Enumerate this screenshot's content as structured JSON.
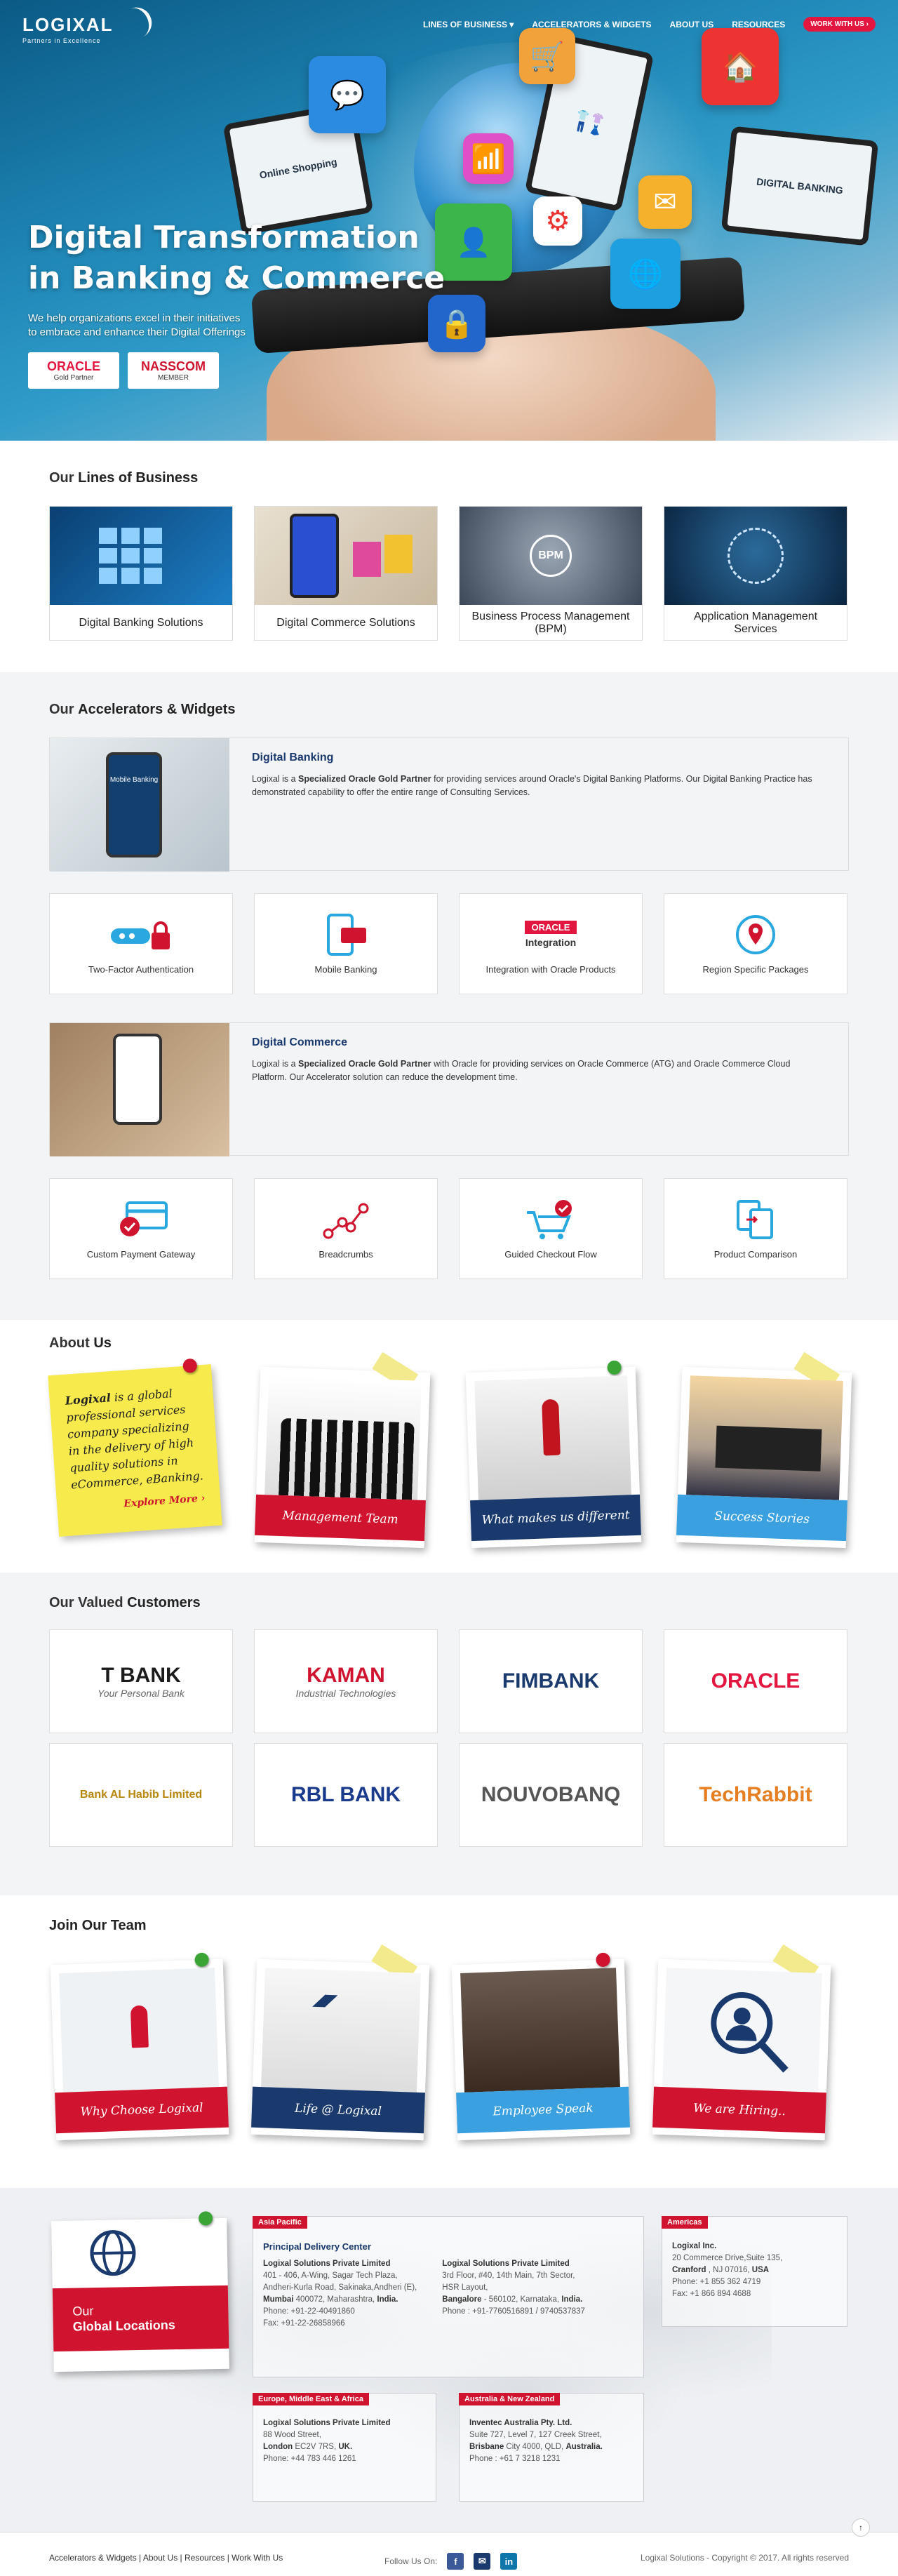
{
  "brand": {
    "name": "LOGIXAL",
    "tagline": "Partners in Excellence"
  },
  "nav": {
    "items": [
      "LINES OF BUSINESS ▾",
      "ACCELERATORS & WIDGETS",
      "ABOUT US",
      "RESOURCES"
    ],
    "cta": "WORK WITH US ›"
  },
  "hero": {
    "title_line1": "Digital Transformation",
    "title_line2": "in Banking & Commerce",
    "subtitle_line1": "We help organizations excel in their initiatives",
    "subtitle_line2": "to embrace and enhance their Digital Offerings",
    "badge1_main": "ORACLE",
    "badge1_sub": "Gold Partner",
    "badge2_main": "NASSCOM",
    "badge2_sub": "MEMBER",
    "screens": {
      "shopping": "Online Shopping",
      "banking": "DIGITAL BANKING"
    }
  },
  "lob": {
    "title_prefix": "Our ",
    "title_bold": "Lines of Business",
    "cards": [
      "Digital Banking Solutions",
      "Digital Commerce Solutions",
      "Business Process Management (BPM)",
      "Application Management Services"
    ]
  },
  "acc": {
    "title_prefix": "Our ",
    "title_bold": "Accelerators & Widgets",
    "banking": {
      "heading": "Digital Banking",
      "pre": "Logixal is a ",
      "bold": "Specialized Oracle Gold Partner",
      "post": " for providing services around Oracle's Digital Banking Platforms. Our Digital Banking Practice has demonstrated capability to offer the entire range of Consulting Services.",
      "phone_text": "Mobile Banking"
    },
    "banking_widgets": [
      "Two-Factor Authentication",
      "Mobile Banking",
      "Integration with Oracle Products",
      "Region Specific Packages"
    ],
    "oracle_integration": {
      "brand": "ORACLE",
      "label": "Integration"
    },
    "commerce": {
      "heading": "Digital Commerce",
      "pre": "Logixal is a ",
      "bold": "Specialized Oracle Gold Partner",
      "post": " with Oracle for providing services on Oracle Commerce (ATG) and Oracle Commerce Cloud Platform. Our Accelerator solution can reduce the development time."
    },
    "commerce_widgets": [
      "Custom Payment Gateway",
      "Breadcrumbs",
      "Guided Checkout Flow",
      "Product Comparison"
    ]
  },
  "about": {
    "title_prefix": "About ",
    "title_bold": "Us",
    "note_bold": "Logixal",
    "note_text": " is a global professional services company specializing in the delivery of high quality solutions in eCommerce, eBanking.",
    "explore": "Explore More ›",
    "cards": [
      "Management Team",
      "What makes us different",
      "Success Stories"
    ]
  },
  "customers": {
    "title_prefix": "Our Valued ",
    "title_bold": "Customers",
    "logos": [
      {
        "name": "T BANK",
        "sub": "Your Personal Bank",
        "color": "#1b1b1b"
      },
      {
        "name": "KAMAN",
        "sub": "Industrial Technologies",
        "color": "#d0142f"
      },
      {
        "name": "FIMBANK",
        "sub": "",
        "color": "#1a3a6e"
      },
      {
        "name": "ORACLE",
        "sub": "",
        "color": "#e3163f"
      },
      {
        "name": "Bank AL Habib Limited",
        "sub": "",
        "color": "#b8860b"
      },
      {
        "name": "RBL BANK",
        "sub": "",
        "color": "#1a3a8e"
      },
      {
        "name": "NOUVOBANQ",
        "sub": "",
        "color": "#555555"
      },
      {
        "name": "TechRabbit",
        "sub": "",
        "color": "#e67e22"
      }
    ]
  },
  "join": {
    "title": "Join Our Team",
    "cards": [
      "Why Choose Logixal",
      "Life @ Logixal",
      "Employee Speak",
      "We are Hiring.."
    ]
  },
  "locations": {
    "card_line1": "Our",
    "card_line2": "Global Locations",
    "asia": {
      "tag": "Asia Pacific",
      "center": "Principal Delivery Center",
      "mumbai": {
        "company": "Logixal Solutions Private Limited",
        "l1": "401 - 406, A-Wing, Sagar Tech Plaza,",
        "l2": "Andheri-Kurla Road, Sakinaka,Andheri (E),",
        "city": "Mumbai",
        "l3": " 400072, Maharashtra, ",
        "country": "India.",
        "phone": "Phone: +91-22-40491860",
        "fax": "Fax: +91-22-26858966"
      },
      "bangalore": {
        "company": "Logixal Solutions Private Limited",
        "l1": "3rd Floor, #40, 14th Main, 7th Sector,",
        "l2": "HSR Layout,",
        "city": "Bangalore",
        "l3": " - 560102, Karnataka, ",
        "country": "India.",
        "phone": "Phone : +91-7760516891 / 9740537837"
      }
    },
    "americas": {
      "tag": "Americas",
      "company": "Logixal Inc.",
      "l1": "20 Commerce Drive,Suite 135,",
      "city": "Cranford",
      "l2": " , NJ 07016, ",
      "country": "USA",
      "phone": "Phone: +1 855 362 4719",
      "fax": "Fax: +1 866 894 4688"
    },
    "emea": {
      "tag": "Europe, Middle East & Africa",
      "company": "Logixal Solutions Private Limited",
      "l1": "88 Wood Street,",
      "city": "London",
      "l2": " EC2V 7RS, ",
      "country": "UK.",
      "phone": "Phone: +44 783 446 1261"
    },
    "anz": {
      "tag": "Australia & New Zealand",
      "company": "Inventec Australia Pty. Ltd.",
      "l1": "Suite 727, Level 7, 127 Creek Street,",
      "city": "Brisbane",
      "l2": " City 4000, QLD, ",
      "country": "Australia.",
      "phone": "Phone : +61 7 3218 1231"
    }
  },
  "footer": {
    "links": [
      "Accelerators & Widgets",
      "About Us",
      "Resources",
      "Work With Us"
    ],
    "follow": "Follow Us On:",
    "social": [
      "f",
      "✉",
      "in"
    ],
    "copyright": "Logixal Solutions - Copyright © 2017. All rights reserved",
    "totop": "↑"
  },
  "colors": {
    "accent": "#d0142f",
    "navy": "#1a3a6e",
    "sticky": "#f6ea4c"
  }
}
